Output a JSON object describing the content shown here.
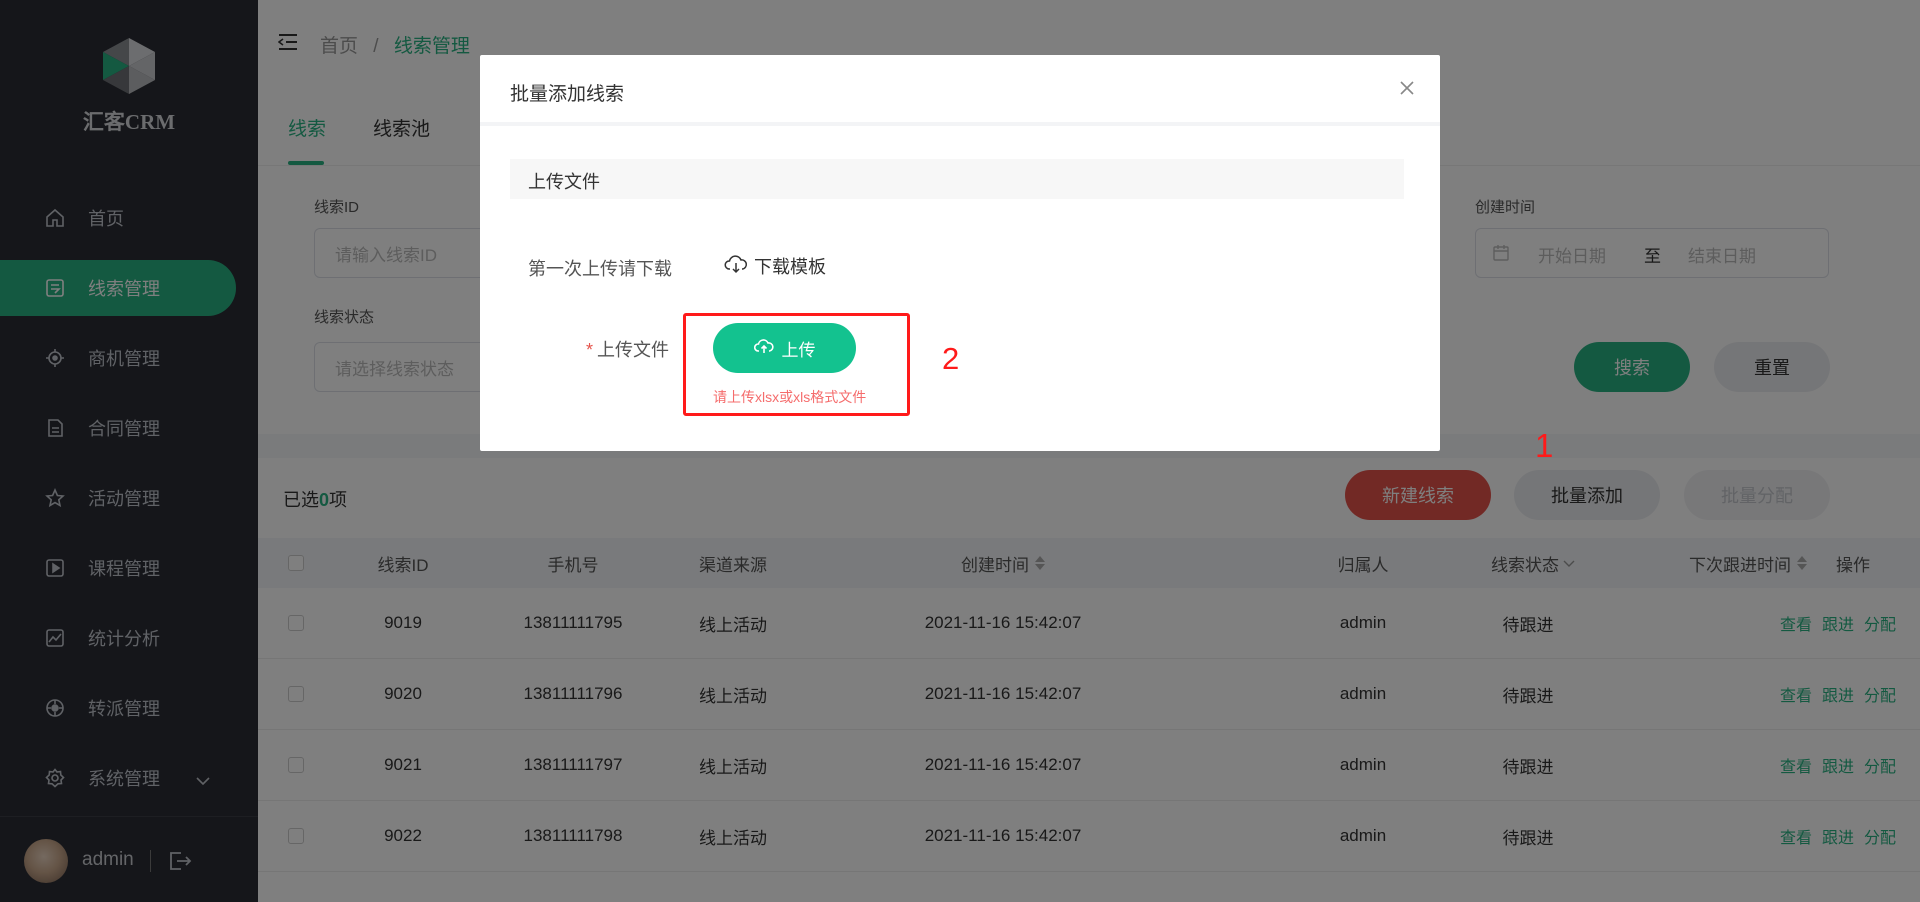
{
  "app": {
    "name": "汇客CRM"
  },
  "sidebar": {
    "items": [
      {
        "label": "首页",
        "icon": "home-icon"
      },
      {
        "label": "线索管理",
        "icon": "clue-icon",
        "active": true
      },
      {
        "label": "商机管理",
        "icon": "target-icon"
      },
      {
        "label": "合同管理",
        "icon": "document-icon"
      },
      {
        "label": "活动管理",
        "icon": "star-icon"
      },
      {
        "label": "课程管理",
        "icon": "video-icon"
      },
      {
        "label": "统计分析",
        "icon": "chart-icon"
      },
      {
        "label": "转派管理",
        "icon": "transfer-icon"
      },
      {
        "label": "系统管理",
        "icon": "gear-icon",
        "expandable": true
      }
    ],
    "user": {
      "name": "admin"
    }
  },
  "breadcrumb": {
    "home": "首页",
    "separator": "/",
    "current": "线索管理"
  },
  "tabs": [
    {
      "label": "线索",
      "active": true
    },
    {
      "label": "线索池"
    }
  ],
  "filters": {
    "clue_id": {
      "label": "线索ID",
      "placeholder": "请输入线索ID"
    },
    "clue_status": {
      "label": "线索状态",
      "placeholder": "请选择线索状态"
    },
    "create_time": {
      "label": "创建时间",
      "start_placeholder": "开始日期",
      "separator": "至",
      "end_placeholder": "结束日期"
    },
    "search_label": "搜索",
    "reset_label": "重置"
  },
  "toolbar": {
    "selected_prefix": "已选",
    "selected_count": "0",
    "selected_suffix": "项",
    "new_label": "新建线索",
    "batch_add_label": "批量添加",
    "batch_assign_label": "批量分配"
  },
  "table": {
    "headers": [
      "线索ID",
      "手机号",
      "渠道来源",
      "创建时间",
      "归属人",
      "线索状态",
      "下次跟进时间",
      "操作"
    ],
    "rows": [
      {
        "id": "9019",
        "phone": "13811111795",
        "channel": "线上活动",
        "created": "2021-11-16 15:42:07",
        "owner": "admin",
        "status": "待跟进",
        "next": ""
      },
      {
        "id": "9020",
        "phone": "13811111796",
        "channel": "线上活动",
        "created": "2021-11-16 15:42:07",
        "owner": "admin",
        "status": "待跟进",
        "next": ""
      },
      {
        "id": "9021",
        "phone": "13811111797",
        "channel": "线上活动",
        "created": "2021-11-16 15:42:07",
        "owner": "admin",
        "status": "待跟进",
        "next": ""
      },
      {
        "id": "9022",
        "phone": "13811111798",
        "channel": "线上活动",
        "created": "2021-11-16 15:42:07",
        "owner": "admin",
        "status": "待跟进",
        "next": ""
      }
    ],
    "actions": [
      "查看",
      "跟进",
      "分配"
    ]
  },
  "modal": {
    "title": "批量添加线索",
    "section_title": "上传文件",
    "hint": "第一次上传请下载",
    "download_label": "下载模板",
    "required_mark": "*",
    "upload_field_label": "上传文件",
    "upload_button_label": "上传",
    "upload_tip": "请上传xlsx或xls格式文件"
  },
  "annotations": {
    "marker_1": "1",
    "marker_2": "2"
  },
  "colors": {
    "primary": "#29b383",
    "danger": "#e5534b",
    "sidebar_bg": "#2a2d34",
    "annotation": "#ff1a1a"
  }
}
